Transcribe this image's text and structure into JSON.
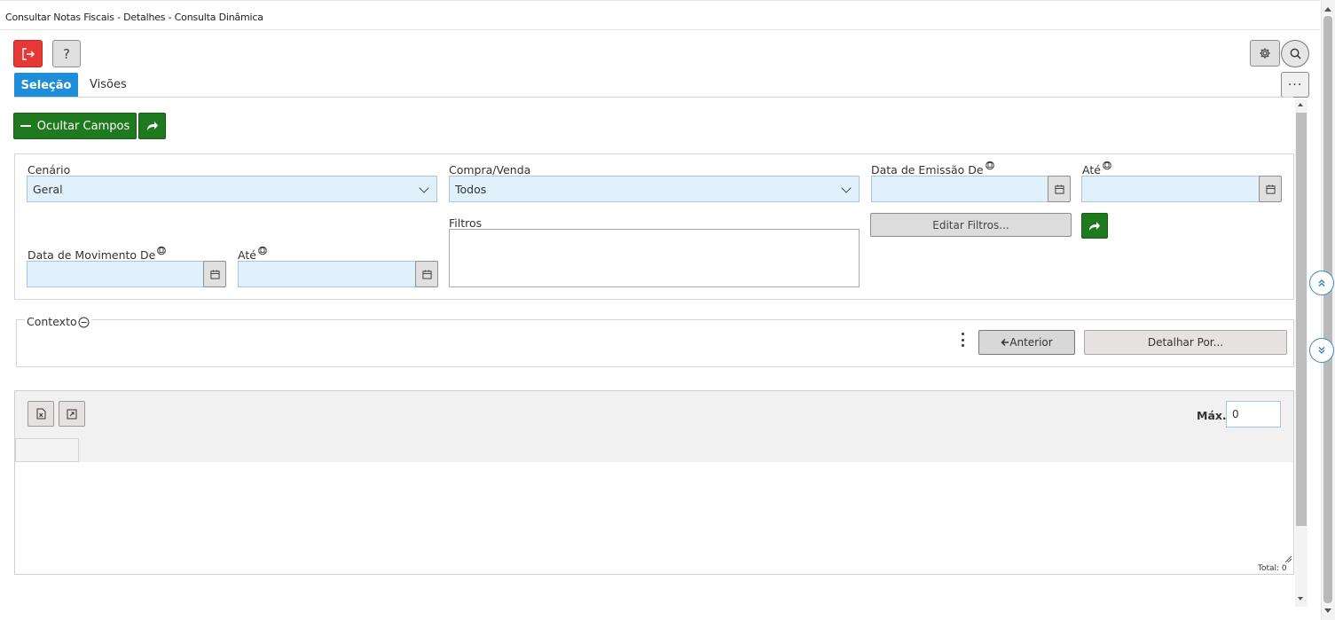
{
  "window": {
    "title": "Consultar Notas Fiscais - Detalhes - Consulta Dinâmica"
  },
  "toolbar": {
    "help_label": "?",
    "more_label": "···"
  },
  "tabs": [
    {
      "label": "Seleção",
      "active": true
    },
    {
      "label": "Visões",
      "active": false
    }
  ],
  "actions": {
    "hide_fields_label": "Ocultar Campos"
  },
  "filters": {
    "cenario": {
      "label": "Cenário",
      "value": "Geral"
    },
    "compra_venda": {
      "label": "Compra/Venda",
      "value": "Todos"
    },
    "data_emissao_de": {
      "label": "Data de Emissão De",
      "value": ""
    },
    "data_emissao_ate": {
      "label": "Até",
      "value": ""
    },
    "data_movimento_de": {
      "label": "Data de Movimento De",
      "value": ""
    },
    "data_movimento_ate": {
      "label": "Até",
      "value": ""
    },
    "filtros": {
      "label": "Filtros",
      "value": ""
    },
    "edit_filters_label": "Editar Filtros..."
  },
  "context": {
    "legend": "Contexto",
    "previous_label": "Anterior",
    "detail_by_label": "Detalhar Por..."
  },
  "grid": {
    "max_label": "Máx.",
    "max_value": "0",
    "total_label": "Total: 0"
  },
  "colors": {
    "accent_blue": "#1f8ed8",
    "action_green": "#1f7a1f",
    "exit_red": "#e53935",
    "input_bg": "#e1f1fb"
  }
}
